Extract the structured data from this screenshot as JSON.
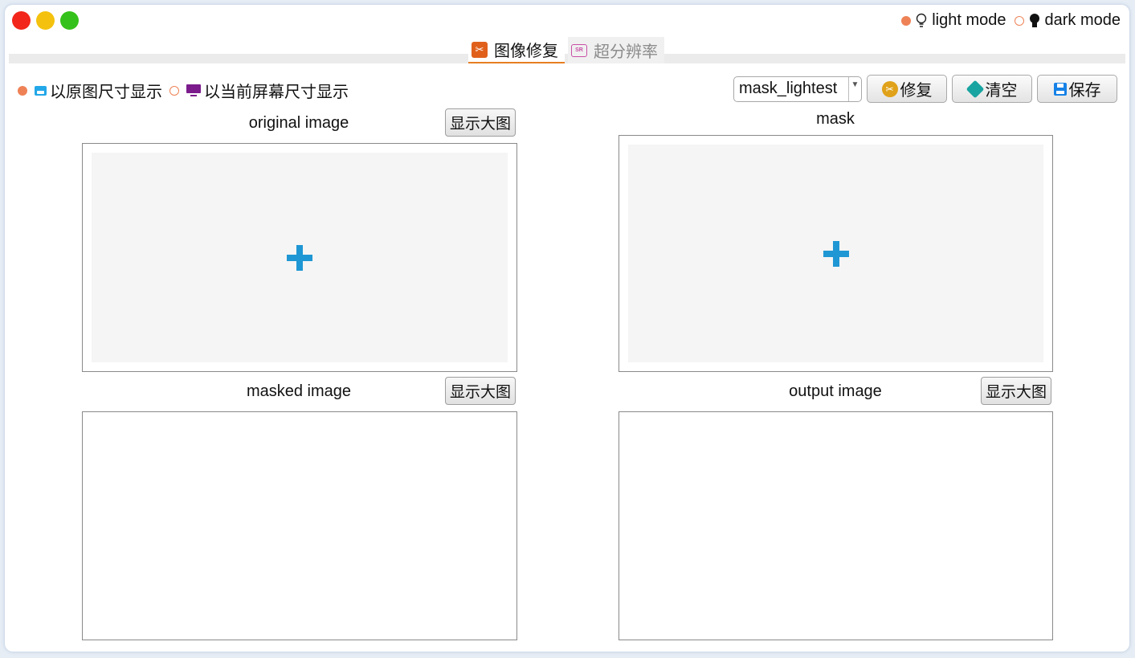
{
  "theme": {
    "light_label": "light mode",
    "dark_label": "dark mode",
    "selected": "light"
  },
  "tabs": [
    {
      "label": "图像修复",
      "icon": "repair-tool-icon",
      "active": true
    },
    {
      "label": "超分辨率",
      "icon": "super-resolution-icon",
      "active": false
    }
  ],
  "display_mode": {
    "option1_label": "以原图尺寸显示",
    "option2_label": "以当前屏幕尺寸显示",
    "selected": "original"
  },
  "toolbar": {
    "mask_select_value": "mask_lightest",
    "repair_label": "修复",
    "clear_label": "清空",
    "save_label": "保存"
  },
  "panels": {
    "original": {
      "title": "original image",
      "button": "显示大图"
    },
    "mask": {
      "title": "mask"
    },
    "masked": {
      "title": "masked image",
      "button": "显示大图"
    },
    "output": {
      "title": "output image",
      "button": "显示大图"
    }
  },
  "colors": {
    "accent_orange": "#ee8256",
    "tab_underline": "#e67e22",
    "plus_blue": "#1f97d4",
    "close_red": "#f2261a",
    "minimize_yellow": "#f4c20e",
    "maximize_green": "#35c11b"
  }
}
